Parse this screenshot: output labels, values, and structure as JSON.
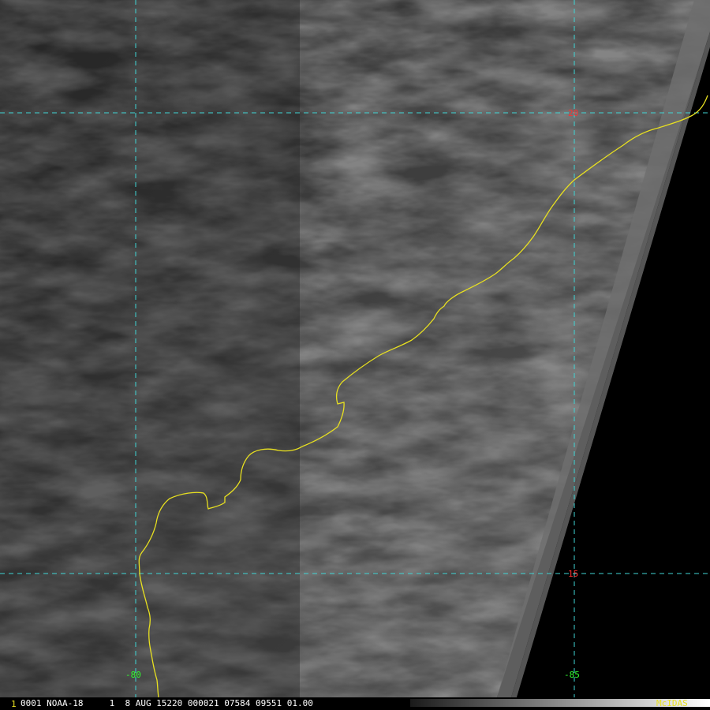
{
  "map": {
    "grid_labels": {
      "lat_20": "20",
      "lat_15": "15",
      "lon_80": "-80",
      "lon_85": "-85"
    },
    "colors": {
      "grid": "#3fd6d6",
      "coastline": "#e8e020",
      "lat_label": "#ff3030",
      "lon_label": "#30ff30",
      "no_data": "#000000"
    }
  },
  "status_bar": {
    "frame_number": "1",
    "info": "0001 NOAA-18     1  8 AUG 15220 000021 07584 09551 01.00",
    "brand": "McIDAS"
  }
}
